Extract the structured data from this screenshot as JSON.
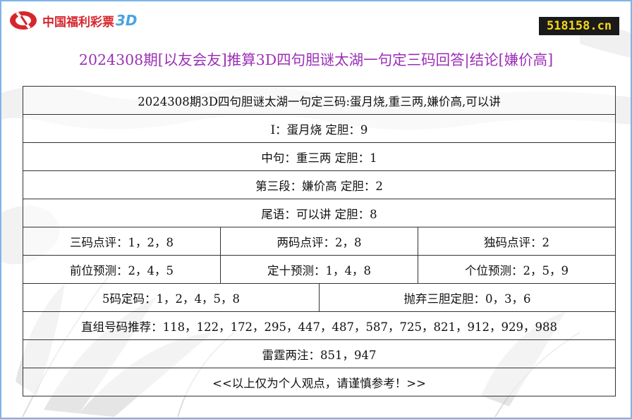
{
  "brand": {
    "logo_text": "中国福利彩票",
    "logo_suffix": "3D",
    "site_badge": "518158.cn"
  },
  "title": "2024308期[以友会友]推算3D四句胆谜太湖一句定三码回答|结论[嫌价高]",
  "rows": {
    "header": "2024308期3D四句胆谜太湖一句定三码:蛋月烧,重三两,嫌价高,可以讲",
    "line1": "I：蛋月烧 定胆：9",
    "line2": "中句：重三两  定胆：1",
    "line3": "第三段：嫌价高  定胆：2",
    "line4": "尾语：可以讲  定胆：8",
    "three_code": "三码点评：1，2，8",
    "two_code": "两码点评：2，8",
    "single_code": "独码点评：2",
    "hundreds": "前位预测：2，4，5",
    "tens": "定十预测：1，4，8",
    "units": "个位预测：2，5，9",
    "five_code": "5码定码：1，2，4，5，8",
    "discard": "抛弃三胆定胆：0，3，6",
    "combos": "直组号码推荐：118，122，172，295，447，487，587，725，821，912，929，988",
    "thunder": "雷霆两注：851，947",
    "disclaimer": "<<以上仅为个人观点，请谨慎参考！>>"
  },
  "colors": {
    "title": "#9b2fb5",
    "border": "#7db4e6",
    "badge_bg": "#1a1a1a",
    "badge_text": "#f3d61a",
    "logo_red": "#d6262d",
    "logo_blue": "#4aa3df"
  }
}
